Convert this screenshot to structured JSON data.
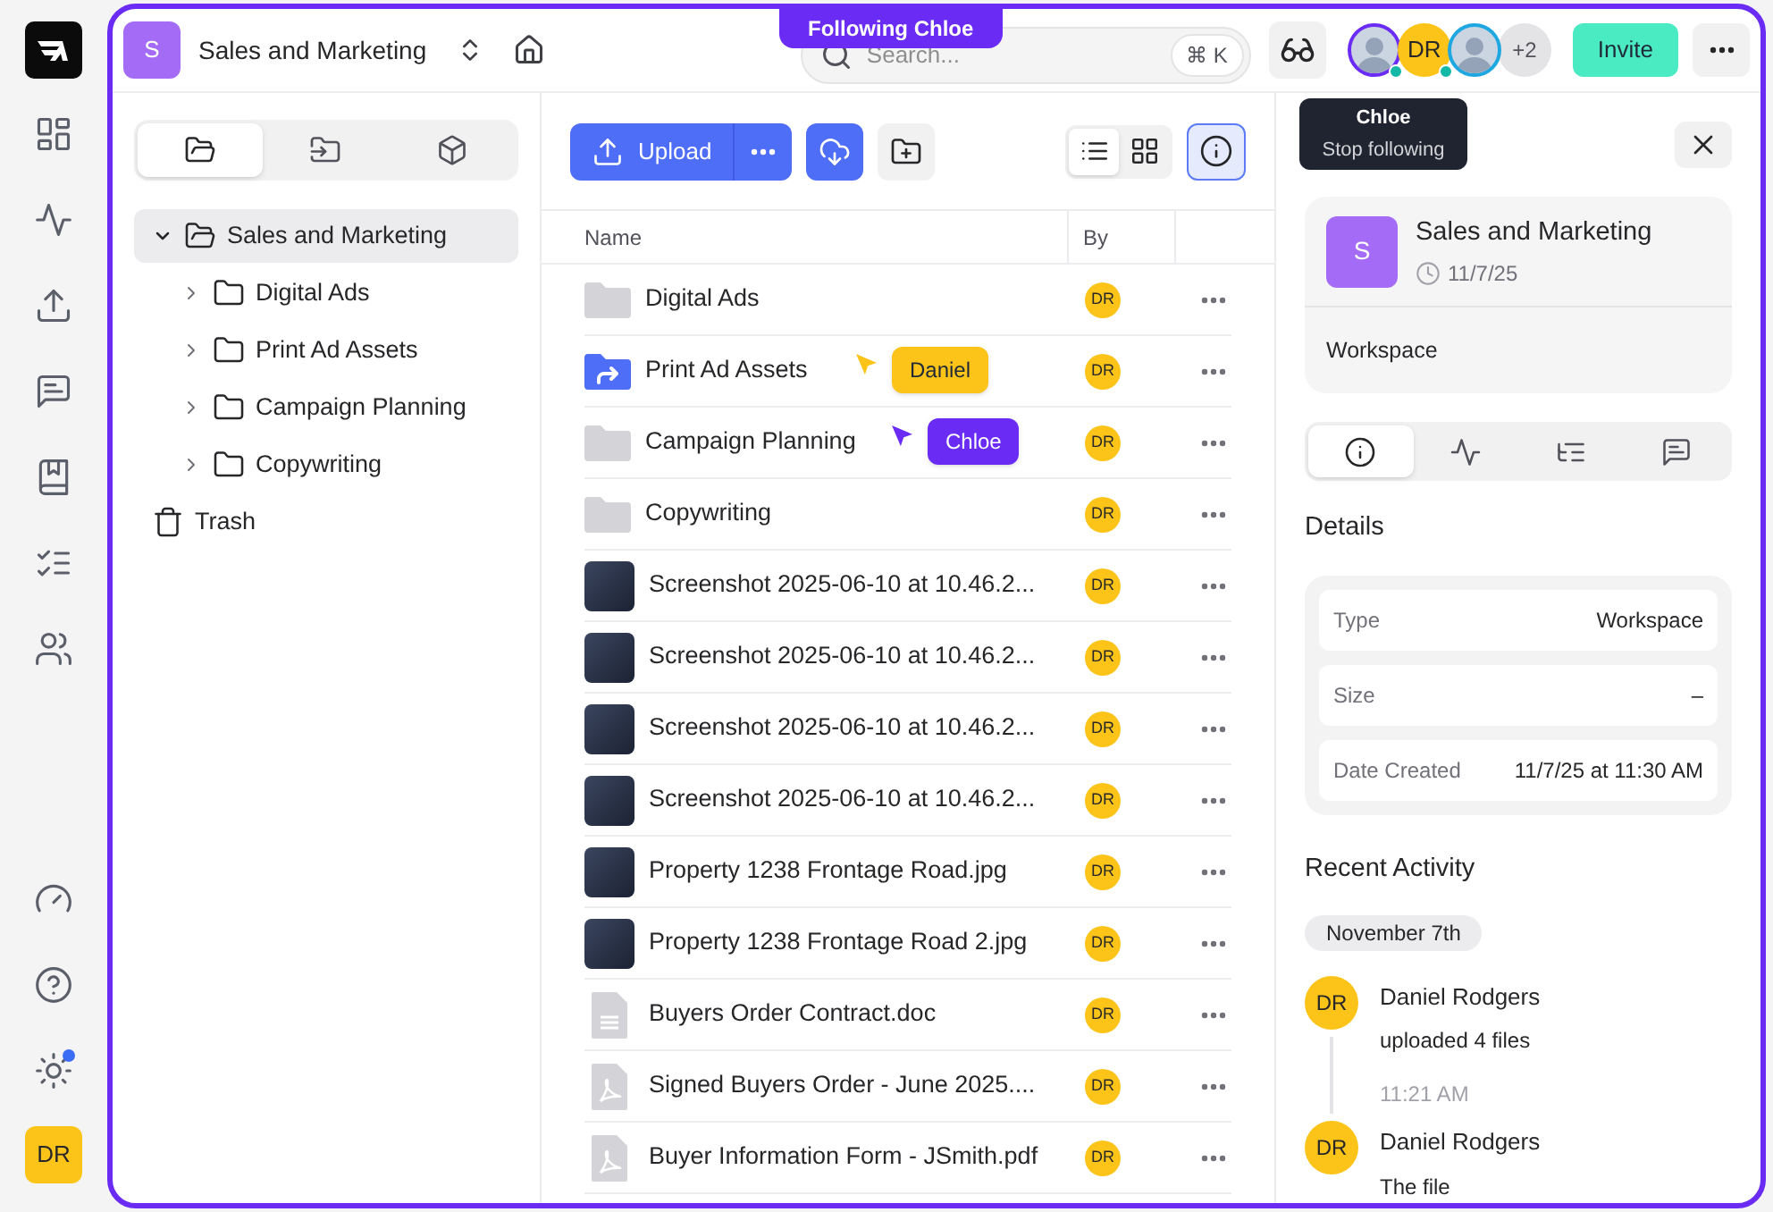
{
  "rail": {
    "notification": true,
    "user_initials": "DR"
  },
  "workspace": {
    "initial": "S",
    "name": "Sales and Marketing"
  },
  "following_banner": "Following Chloe",
  "search": {
    "placeholder": "Search...",
    "shortcut": "⌘ K"
  },
  "collaborators": [
    {
      "kind": "photo",
      "color": "#6a2cf5",
      "online": true
    },
    {
      "kind": "initials",
      "initials": "DR",
      "color": "#fcc419",
      "online": true
    },
    {
      "kind": "photo",
      "color": "#1ea7e0",
      "online": false
    }
  ],
  "more_collaborators": "+2",
  "tooltip": {
    "title": "Chloe",
    "action": "Stop following"
  },
  "invite_button": "Invite",
  "tree": {
    "tabs": [
      {
        "kind": "folders",
        "selected": true
      },
      {
        "kind": "import",
        "selected": false
      },
      {
        "kind": "packages",
        "selected": false
      }
    ],
    "items": [
      {
        "kind": "folder",
        "label": "Sales and Marketing",
        "expanded": true,
        "selected": true,
        "children": [
          {
            "kind": "folder",
            "label": "Digital Ads",
            "expanded": false,
            "selected": false
          },
          {
            "kind": "folder",
            "label": "Print Ad Assets",
            "expanded": false,
            "selected": false
          },
          {
            "kind": "folder",
            "label": "Campaign Planning",
            "expanded": false,
            "selected": false
          },
          {
            "kind": "folder",
            "label": "Copywriting",
            "expanded": false,
            "selected": false
          }
        ]
      },
      {
        "kind": "trash",
        "label": "Trash",
        "selected": false
      }
    ]
  },
  "toolbar": {
    "upload": "Upload",
    "views": [
      {
        "kind": "list",
        "selected": true
      },
      {
        "kind": "grid",
        "selected": false
      }
    ],
    "info_active": true
  },
  "table": {
    "columns": [
      "Name",
      "By"
    ],
    "rows": [
      {
        "kind": "folder",
        "name": "Digital Ads",
        "by": "DR"
      },
      {
        "kind": "shared-folder",
        "name": "Print Ad Assets",
        "by": "DR",
        "cursor": {
          "name": "Daniel",
          "color": "#fcc419"
        }
      },
      {
        "kind": "folder",
        "name": "Campaign Planning",
        "by": "DR",
        "cursor": {
          "name": "Chloe",
          "color": "#6a2cf5"
        }
      },
      {
        "kind": "folder",
        "name": "Copywriting",
        "by": "DR"
      },
      {
        "kind": "image",
        "name": "Screenshot 2025-06-10 at 10.46.2...",
        "by": "DR"
      },
      {
        "kind": "image",
        "name": "Screenshot 2025-06-10 at 10.46.2...",
        "by": "DR"
      },
      {
        "kind": "image",
        "name": "Screenshot 2025-06-10 at 10.46.2...",
        "by": "DR"
      },
      {
        "kind": "image",
        "name": "Screenshot 2025-06-10 at 10.46.2...",
        "by": "DR"
      },
      {
        "kind": "image",
        "name": "Property 1238 Frontage Road.jpg",
        "by": "DR"
      },
      {
        "kind": "image",
        "name": "Property 1238 Frontage Road 2.jpg",
        "by": "DR"
      },
      {
        "kind": "doc",
        "name": "Buyers Order Contract.doc",
        "by": "DR"
      },
      {
        "kind": "pdf",
        "name": "Signed Buyers Order - June 2025....",
        "by": "DR"
      },
      {
        "kind": "pdf",
        "name": "Buyer Information Form - JSmith.pdf",
        "by": "DR"
      }
    ]
  },
  "details": {
    "initial": "S",
    "title": "Sales and Marketing",
    "date": "11/7/25",
    "type_label": "Workspace",
    "tabs": [
      {
        "kind": "info",
        "selected": true
      },
      {
        "kind": "activity",
        "selected": false
      },
      {
        "kind": "tree",
        "selected": false
      },
      {
        "kind": "comments",
        "selected": false
      }
    ],
    "heading": "Details",
    "properties": [
      {
        "label": "Type",
        "value": "Workspace"
      },
      {
        "label": "Size",
        "value": "–"
      },
      {
        "label": "Date Created",
        "value": "11/7/25 at 11:30 AM"
      }
    ],
    "activity_heading": "Recent Activity",
    "date_chip": "November 7th",
    "activity": [
      {
        "initials": "DR",
        "name": "Daniel Rodgers",
        "text": "uploaded 4 files",
        "time": "11:21 AM"
      },
      {
        "initials": "DR",
        "name": "Daniel Rodgers",
        "text": "The file"
      }
    ]
  }
}
